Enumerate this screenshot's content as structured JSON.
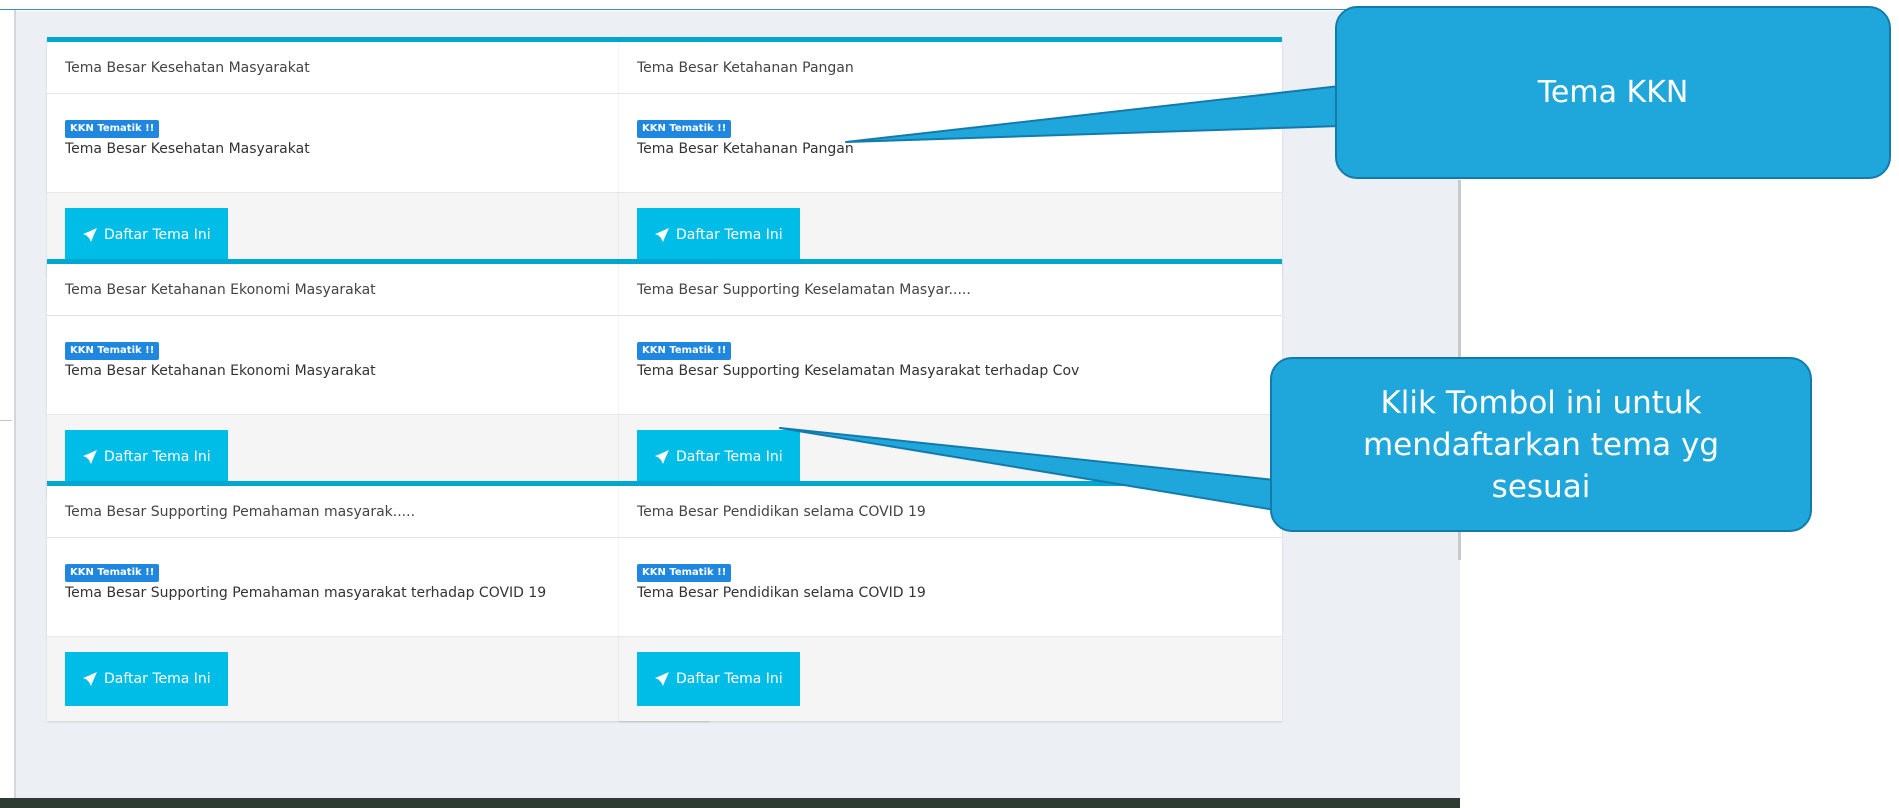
{
  "cards": [
    {
      "header": "Tema Besar Kesehatan Masyarakat",
      "badge": "KKN Tematik !!",
      "text": "Tema Besar Kesehatan Masyarakat",
      "button": "Daftar Tema Ini"
    },
    {
      "header": "Tema Besar Ketahanan Pangan",
      "badge": "KKN Tematik !!",
      "text": "Tema Besar Ketahanan Pangan",
      "button": "Daftar Tema Ini"
    },
    {
      "header": "Tema Besar Ketahanan Ekonomi Masyarakat",
      "badge": "KKN Tematik !!",
      "text": "Tema Besar Ketahanan Ekonomi Masyarakat",
      "button": "Daftar Tema Ini"
    },
    {
      "header": "Tema Besar Supporting Keselamatan Masyar.....",
      "badge": "KKN Tematik !!",
      "text": "Tema Besar Supporting Keselamatan Masyarakat terhadap Cov",
      "button": "Daftar Tema Ini"
    },
    {
      "header": "Tema Besar Supporting Pemahaman masyarak.....",
      "badge": "KKN Tematik !!",
      "text": "Tema Besar Supporting Pemahaman masyarakat terhadap COVID 19",
      "button": "Daftar Tema Ini"
    },
    {
      "header": "Tema Besar Pendidikan selama COVID 19",
      "badge": "KKN Tematik !!",
      "text": "Tema Besar Pendidikan selama COVID 19",
      "button": "Daftar Tema Ini"
    }
  ],
  "button_icon": "rocket-icon",
  "annotations": {
    "tema_kkn": "Tema KKN",
    "klik_tombol": "Klik Tombol ini untuk\nmendaftarkan tema yg\nsesuai"
  },
  "colors": {
    "card_accent": "#00a7d0",
    "button": "#00bde8",
    "badge": "#1f87e0",
    "callout_fill": "#1fa7dc",
    "callout_border": "#137bac"
  }
}
